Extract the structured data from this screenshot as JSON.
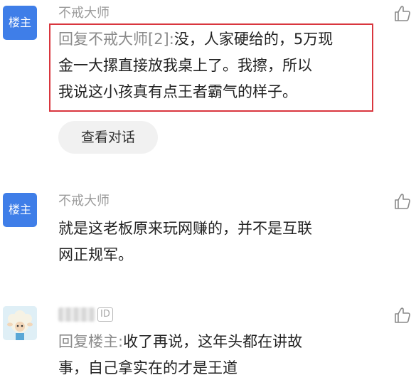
{
  "comments": [
    {
      "avatar_label": "楼主",
      "username": "不戒大师",
      "reply_prefix": "回复不戒大师[2]:",
      "text": "没，人家硬给的，5万现金一大摞直接放我桌上了。我擦，所以我说这小孩真有点王者霸气的样子。",
      "lines": [
        "回复不戒大师[2]:没，人家硬给的，5万现",
        "金一大摞直接放我桌上了。我擦，所以",
        "我说这小孩真有点王者霸气的样子。"
      ],
      "highlighted": true,
      "view_dialog_label": "查看对话"
    },
    {
      "avatar_label": "楼主",
      "username": "不戒大师",
      "lines": [
        "就是这老板原来玩网赚的，并不是互联",
        "网正规军。"
      ]
    },
    {
      "avatar_icon": "sheep-avatar-icon",
      "username_blurred": true,
      "id_badge": "ID",
      "reply_prefix": "回复楼主:",
      "lines": [
        "回复楼主:收了再说，这年头都在讲故",
        "事，自己拿实在的才是王道"
      ]
    }
  ],
  "icons": {
    "like": "thumbs-up-icon"
  },
  "colors": {
    "avatar_blue": "#3f7ee8",
    "highlight_border": "#d9363e",
    "username_gray": "#9b9b9b",
    "text_dark": "#222222"
  }
}
